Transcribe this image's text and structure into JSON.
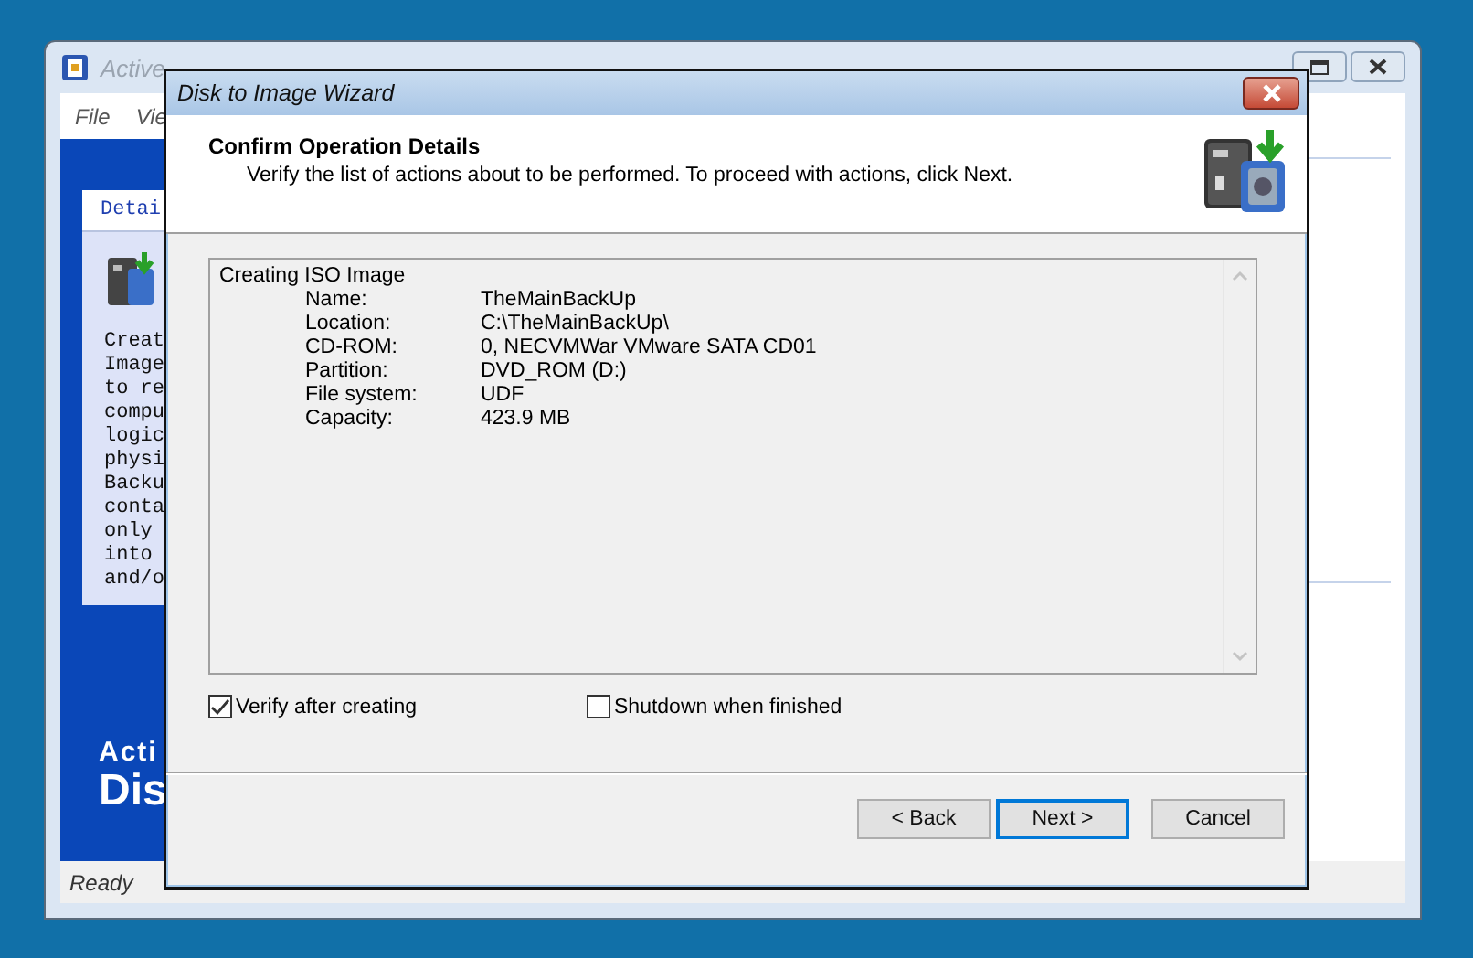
{
  "background_window": {
    "title": "Active",
    "menu": [
      "File",
      "Vie"
    ],
    "panel_tab": "Detai",
    "panel_text_lines": [
      "Creat",
      "Image",
      "to re",
      "compu",
      "logic",
      "physi",
      "Backu",
      "conta",
      "only",
      "into",
      "and/o"
    ],
    "brand_lines": [
      "Acti",
      "Dis"
    ],
    "status": "Ready"
  },
  "dialog": {
    "title": "Disk to Image Wizard",
    "heading": "Confirm Operation Details",
    "subheading": "Verify the list of actions about to be performed. To proceed with actions, click Next.",
    "details": {
      "title": "Creating ISO Image",
      "rows": [
        {
          "label": "Name:",
          "value": "TheMainBackUp"
        },
        {
          "label": "Location:",
          "value": "C:\\TheMainBackUp\\"
        },
        {
          "label": "CD-ROM:",
          "value": "0, NECVMWar VMware SATA CD01"
        },
        {
          "label": "Partition:",
          "value": "DVD_ROM (D:)"
        },
        {
          "label": "File system:",
          "value": "UDF"
        },
        {
          "label": "Capacity:",
          "value": "423.9 MB"
        }
      ]
    },
    "options": [
      {
        "label": "Verify after creating",
        "checked": true
      },
      {
        "label": "Shutdown when finished",
        "checked": false
      }
    ],
    "buttons": [
      {
        "label": "< Back",
        "focused": false
      },
      {
        "label": "Next >",
        "focused": true
      },
      {
        "label": "Cancel",
        "focused": false
      }
    ]
  }
}
